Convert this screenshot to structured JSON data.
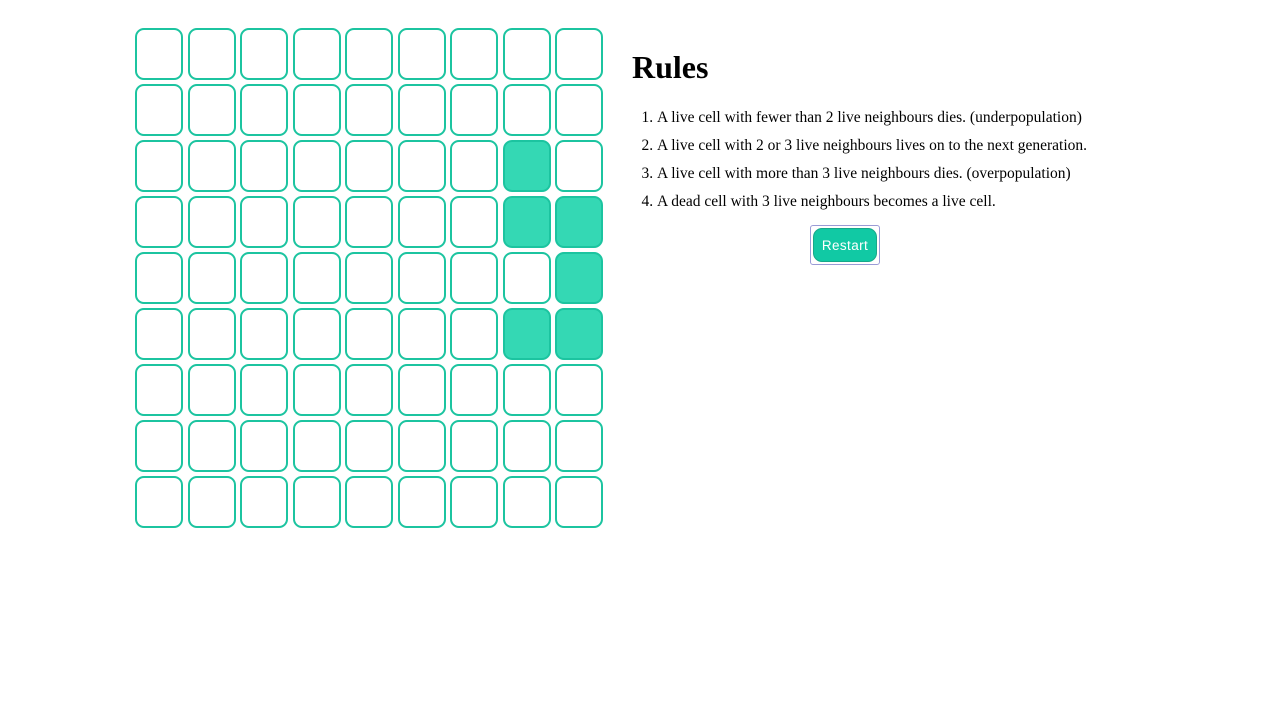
{
  "colors": {
    "cell_border": "#1cc4a0",
    "cell_alive": "#34d8b4",
    "cell_dead": "#ffffff",
    "button_bg": "#11c9a4",
    "button_text": "#ffffff"
  },
  "board": {
    "rows": 9,
    "cols": 9,
    "grid": [
      [
        0,
        0,
        0,
        0,
        0,
        0,
        0,
        0,
        0
      ],
      [
        0,
        0,
        0,
        0,
        0,
        0,
        0,
        0,
        0
      ],
      [
        0,
        0,
        0,
        0,
        0,
        0,
        0,
        1,
        0
      ],
      [
        0,
        0,
        0,
        0,
        0,
        0,
        0,
        1,
        1
      ],
      [
        0,
        0,
        0,
        0,
        0,
        0,
        0,
        0,
        1
      ],
      [
        0,
        0,
        0,
        0,
        0,
        0,
        0,
        1,
        1
      ],
      [
        0,
        0,
        0,
        0,
        0,
        0,
        0,
        0,
        0
      ],
      [
        0,
        0,
        0,
        0,
        0,
        0,
        0,
        0,
        0
      ],
      [
        0,
        0,
        0,
        0,
        0,
        0,
        0,
        0,
        0
      ]
    ]
  },
  "rules": {
    "title": "Rules",
    "items": [
      "A live cell with fewer than 2 live neighbours dies. (underpopulation)",
      "A live cell with 2 or 3 live neighbours lives on to the next generation.",
      "A live cell with more than 3 live neighbours dies. (overpopulation)",
      "A dead cell with 3 live neighbours becomes a live cell."
    ]
  },
  "controls": {
    "restart_label": "Restart"
  }
}
